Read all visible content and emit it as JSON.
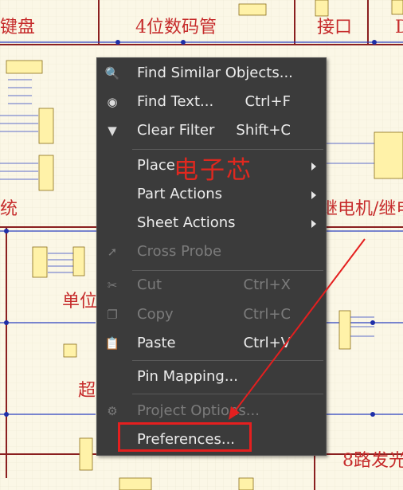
{
  "schematic": {
    "labels": {
      "keyboard": "键盘",
      "seven_seg": "4位数码管",
      "port": "接口",
      "d": "D",
      "system": "统",
      "relay": "继电机/继电",
      "unit": "单位",
      "super": "超",
      "leds": "8路发光"
    }
  },
  "watermark": "电子芯",
  "context_menu": {
    "items": [
      {
        "icon": "search-icon",
        "label": "Find Similar Objects...",
        "shortcut": ""
      },
      {
        "icon": "binoculars-icon",
        "label": "Find Text...",
        "shortcut": "Ctrl+F"
      },
      {
        "icon": "clear-filter-icon",
        "label": "Clear Filter",
        "shortcut": "Shift+C"
      },
      {
        "label": "Place",
        "submenu": true
      },
      {
        "label": "Part Actions",
        "submenu": true
      },
      {
        "label": "Sheet Actions",
        "submenu": true
      },
      {
        "icon": "cross-probe-icon",
        "label": "Cross Probe",
        "disabled": true
      },
      {
        "icon": "scissors-icon",
        "label": "Cut",
        "shortcut": "Ctrl+X",
        "disabled": true
      },
      {
        "icon": "copy-icon",
        "label": "Copy",
        "shortcut": "Ctrl+C",
        "disabled": true
      },
      {
        "icon": "paste-icon",
        "label": "Paste",
        "shortcut": "Ctrl+V"
      },
      {
        "label": "Pin Mapping..."
      },
      {
        "icon": "project-options-icon",
        "label": "Project Options...",
        "disabled": true
      },
      {
        "label": "Preferences..."
      }
    ]
  },
  "colors": {
    "menu_bg": "#3b3b3b",
    "highlight": "#e41f1f",
    "schematic_label": "#c62b2b"
  }
}
